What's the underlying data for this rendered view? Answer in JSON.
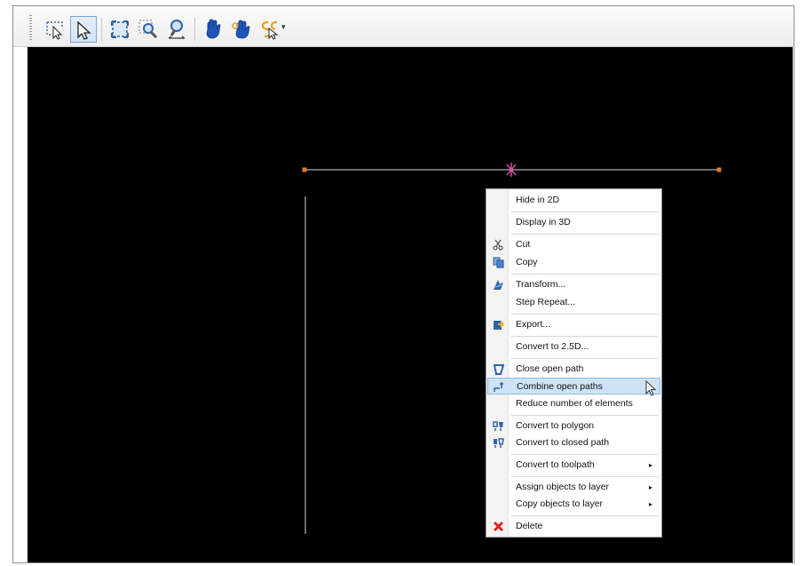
{
  "toolbar": {
    "buttons": [
      {
        "icon": "lasso-select-icon"
      },
      {
        "icon": "select-arrow-icon",
        "active": true
      },
      {
        "icon": "zoom-extents-icon"
      },
      {
        "icon": "zoom-window-icon"
      },
      {
        "icon": "zoom-dynamic-icon"
      },
      {
        "icon": "pan-hand-icon"
      },
      {
        "icon": "rotate-hand-icon"
      },
      {
        "icon": "snap-dropdown-icon"
      }
    ],
    "dropdown_glyph": "▾"
  },
  "canvas": {
    "background": "#000000",
    "line_color": "#d8d8d8",
    "handle_color": "#e07a2a"
  },
  "context_menu": {
    "items": [
      {
        "label": "Hide in 2D"
      },
      {
        "label": "Display in 3D"
      },
      {
        "label": "Cut",
        "icon": "scissors-icon"
      },
      {
        "label": "Copy",
        "icon": "copy-icon"
      },
      {
        "label": "Transform...",
        "icon": "transform-icon"
      },
      {
        "label": "Step  Repeat..."
      },
      {
        "label": "Export...",
        "icon": "export-icon"
      },
      {
        "label": "Convert to 2.5D..."
      },
      {
        "label": "Close open path",
        "icon": "close-path-icon"
      },
      {
        "label": "Combine open paths",
        "icon": "combine-paths-icon",
        "highlighted": true
      },
      {
        "label": "Reduce number of elements"
      },
      {
        "label": "Convert to polygon",
        "icon": "polygon-icon"
      },
      {
        "label": "Convert to closed path",
        "icon": "closed-path-icon"
      },
      {
        "label": "Convert to toolpath",
        "submenu": "▸"
      },
      {
        "label": "Assign objects to layer",
        "submenu": "▸"
      },
      {
        "label": "Copy objects to layer",
        "submenu": "▸"
      },
      {
        "label": "Delete",
        "icon": "delete-icon"
      }
    ]
  }
}
